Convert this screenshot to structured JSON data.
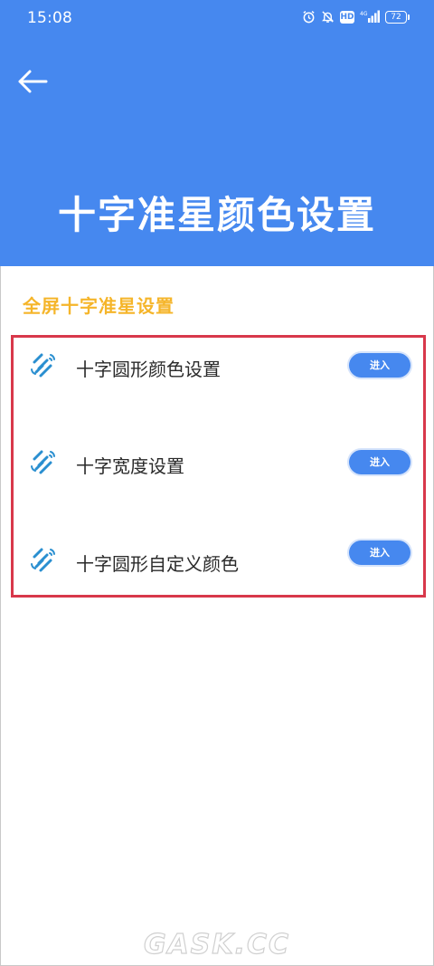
{
  "status_bar": {
    "time": "15:08",
    "network": "4G",
    "battery": "72",
    "hd": "HD"
  },
  "header": {
    "title": "十字准星颜色设置",
    "background_color": "#4688ef"
  },
  "section": {
    "title": "全屏十字准星设置",
    "title_color": "#f5b52a"
  },
  "items": [
    {
      "label": "十字圆形颜色设置",
      "button": "进入",
      "icon": "satellite-icon"
    },
    {
      "label": "十字宽度设置",
      "button": "进入",
      "icon": "satellite-icon"
    },
    {
      "label": "十字圆形自定义颜色",
      "button": "进入",
      "icon": "satellite-icon"
    }
  ],
  "highlight_color": "#d8384b",
  "watermark": "GASK.CC"
}
